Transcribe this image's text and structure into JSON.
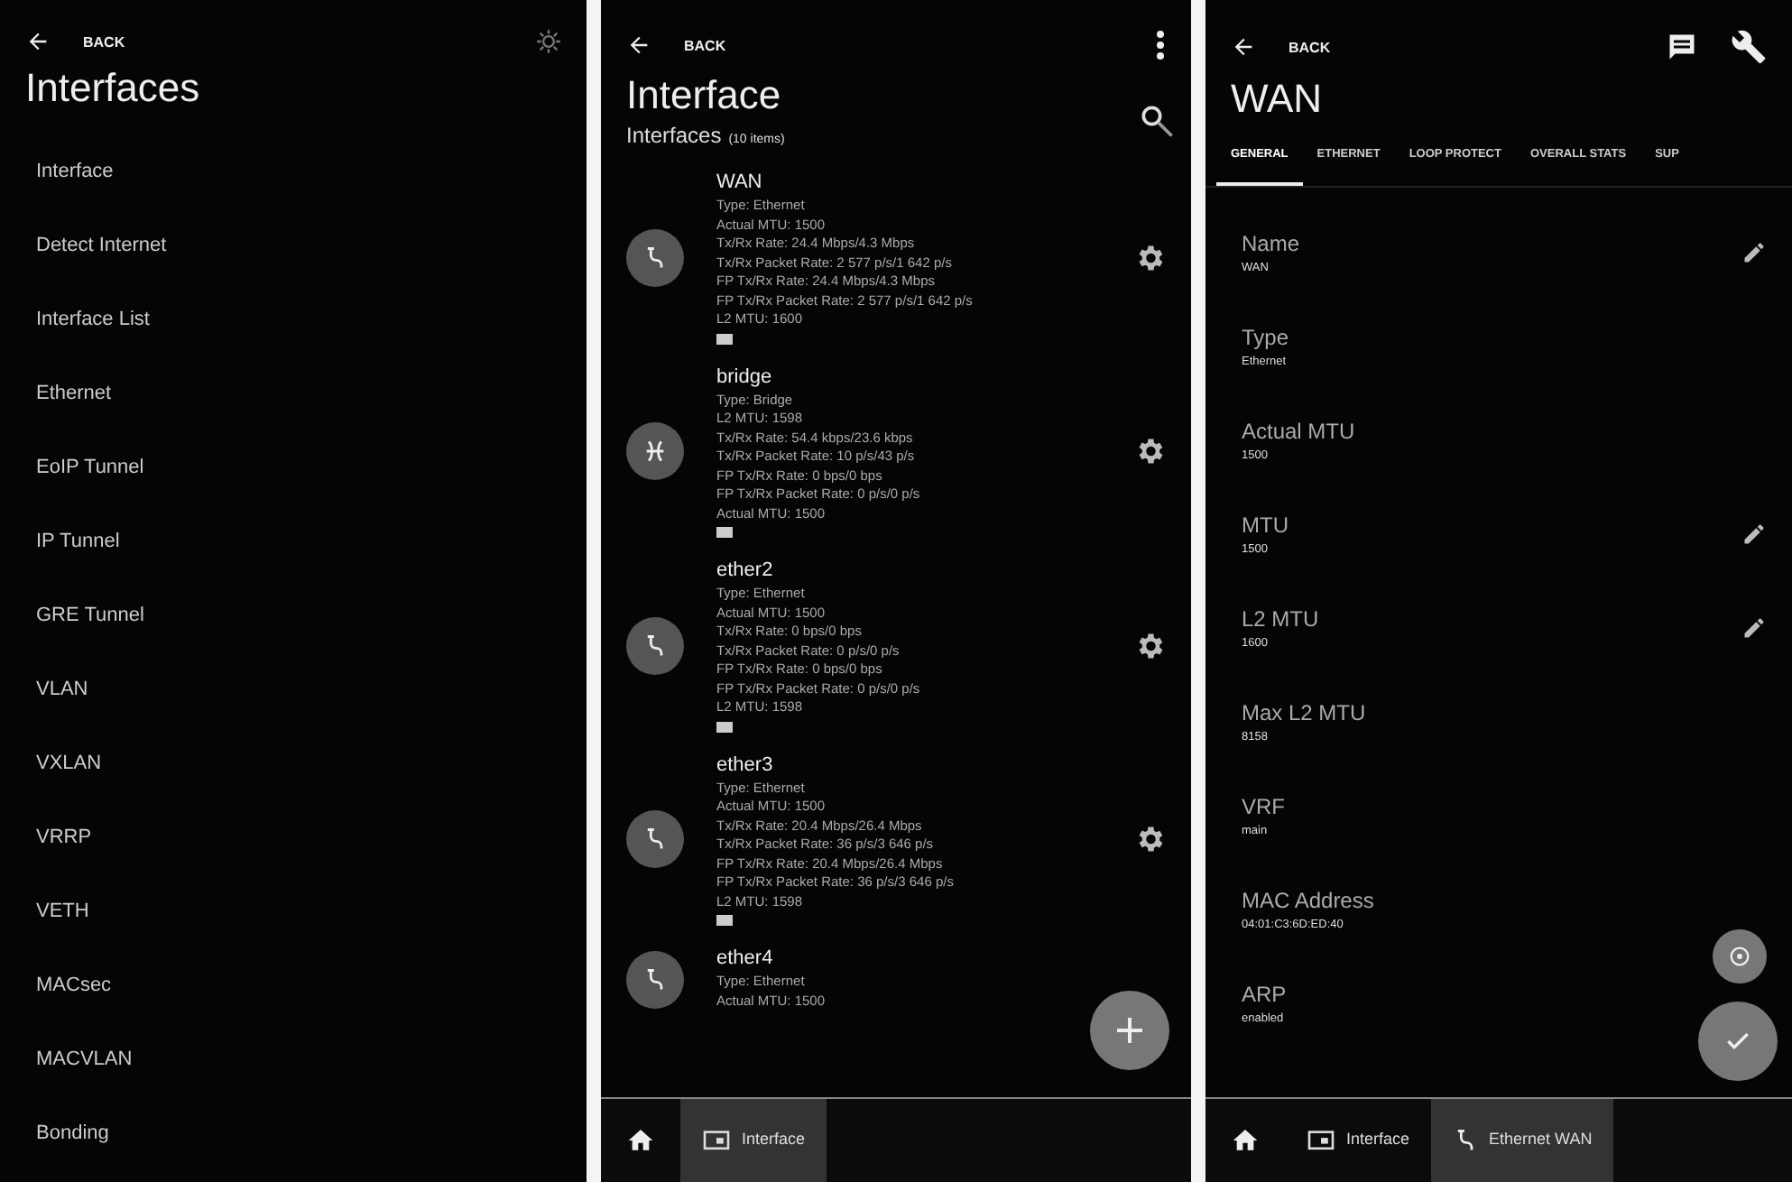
{
  "screens": [
    {
      "kind": "menu",
      "back": "BACK",
      "title": "Interfaces",
      "items": [
        "Interface",
        "Detect Internet",
        "Interface List",
        "Ethernet",
        "EoIP Tunnel",
        "IP Tunnel",
        "GRE Tunnel",
        "VLAN",
        "VXLAN",
        "VRRP",
        "VETH",
        "MACsec",
        "MACVLAN",
        "Bonding"
      ]
    },
    {
      "kind": "list",
      "back": "BACK",
      "title": "Interface",
      "subtitle": "Interfaces",
      "count": "(10 items)",
      "rows": [
        {
          "kind": "ethernet",
          "name": "WAN",
          "details": [
            "Type: Ethernet",
            "Actual MTU: 1500",
            "Tx/Rx Rate: 24.4 Mbps/4.3 Mbps",
            "Tx/Rx Packet Rate: 2 577 p/s/1 642 p/s",
            "FP Tx/Rx Rate: 24.4 Mbps/4.3 Mbps",
            "FP Tx/Rx Packet Rate: 2 577 p/s/1 642 p/s",
            "L2 MTU: 1600"
          ]
        },
        {
          "kind": "bridge",
          "name": "bridge",
          "details": [
            "Type: Bridge",
            "L2 MTU: 1598",
            "Tx/Rx Rate: 54.4 kbps/23.6 kbps",
            "Tx/Rx Packet Rate: 10 p/s/43 p/s",
            "FP Tx/Rx Rate: 0 bps/0 bps",
            "FP Tx/Rx Packet Rate: 0 p/s/0 p/s",
            "Actual MTU: 1500"
          ]
        },
        {
          "kind": "ethernet",
          "name": "ether2",
          "details": [
            "Type: Ethernet",
            "Actual MTU: 1500",
            "Tx/Rx Rate: 0 bps/0 bps",
            "Tx/Rx Packet Rate: 0 p/s/0 p/s",
            "FP Tx/Rx Rate: 0 bps/0 bps",
            "FP Tx/Rx Packet Rate: 0 p/s/0 p/s",
            "L2 MTU: 1598"
          ]
        },
        {
          "kind": "ethernet",
          "name": "ether3",
          "details": [
            "Type: Ethernet",
            "Actual MTU: 1500",
            "Tx/Rx Rate: 20.4 Mbps/26.4 Mbps",
            "Tx/Rx Packet Rate: 36 p/s/3 646 p/s",
            "FP Tx/Rx Rate: 20.4 Mbps/26.4 Mbps",
            "FP Tx/Rx Packet Rate: 36 p/s/3 646 p/s",
            "L2 MTU: 1598"
          ]
        },
        {
          "kind": "ethernet",
          "name": "ether4",
          "details": [
            "Type: Ethernet",
            "Actual MTU: 1500"
          ]
        }
      ],
      "nav": [
        {
          "kind": "interface",
          "label": "Interface",
          "selected": true
        }
      ]
    },
    {
      "kind": "detail",
      "back": "BACK",
      "title": "WAN",
      "tabs": [
        {
          "label": "GENERAL",
          "selected": true
        },
        {
          "label": "ETHERNET",
          "selected": false
        },
        {
          "label": "LOOP PROTECT",
          "selected": false
        },
        {
          "label": "OVERALL STATS",
          "selected": false
        },
        {
          "label": "SUP",
          "selected": false
        }
      ],
      "fields": [
        {
          "label": "Name",
          "value": "WAN",
          "editable": true
        },
        {
          "label": "Type",
          "value": "Ethernet",
          "editable": false
        },
        {
          "label": "Actual MTU",
          "value": "1500",
          "editable": false
        },
        {
          "label": "MTU",
          "value": "1500",
          "editable": true
        },
        {
          "label": "L2 MTU",
          "value": "1600",
          "editable": true
        },
        {
          "label": "Max L2 MTU",
          "value": "8158",
          "editable": false
        },
        {
          "label": "VRF",
          "value": "main",
          "editable": false
        },
        {
          "label": "MAC Address",
          "value": "04:01:C3:6D:ED:40",
          "editable": false
        },
        {
          "label": "ARP",
          "value": "enabled",
          "editable": false
        }
      ],
      "nav": [
        {
          "kind": "interface",
          "label": "Interface",
          "selected": false
        },
        {
          "kind": "ethernet",
          "label": "Ethernet WAN",
          "selected": true
        }
      ]
    }
  ]
}
